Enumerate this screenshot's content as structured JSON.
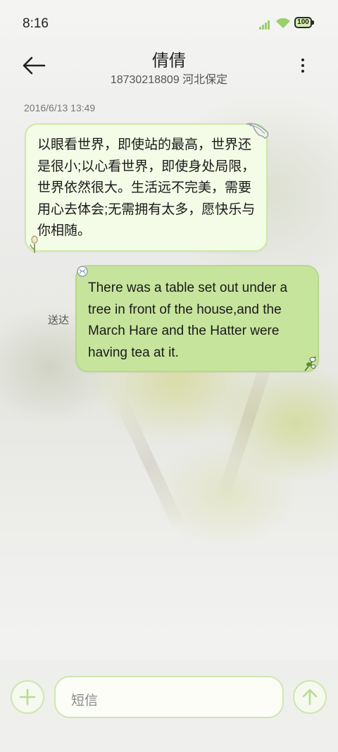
{
  "status_bar": {
    "time": "8:16",
    "battery": "100"
  },
  "header": {
    "name": "倩倩",
    "number_location": "18730218809 河北保定"
  },
  "conversation": {
    "timestamp": "2016/6/13 13:49",
    "incoming_text": "以眼看世界，即使站的最高，世界还是很小;以心看世界，即使身处局限，世界依然很大。生活远不完美，需要用心去体会;无需拥有太多，愿快乐与你相随。",
    "outgoing_text": "There was a table set out under a tree in front of the house,and the March Hare and the Hatter were having tea at it.",
    "delivery_status": "送达"
  },
  "composer": {
    "placeholder": "短信"
  },
  "colors": {
    "accent": "#c7e49d",
    "accent_border": "#cfe6b0",
    "incoming_bg": "#f4fbe6"
  },
  "icons": [
    "back-arrow-icon",
    "more-vert-icon",
    "signal-icon",
    "wifi-icon",
    "battery-icon",
    "add-icon",
    "send-arrow-icon"
  ]
}
